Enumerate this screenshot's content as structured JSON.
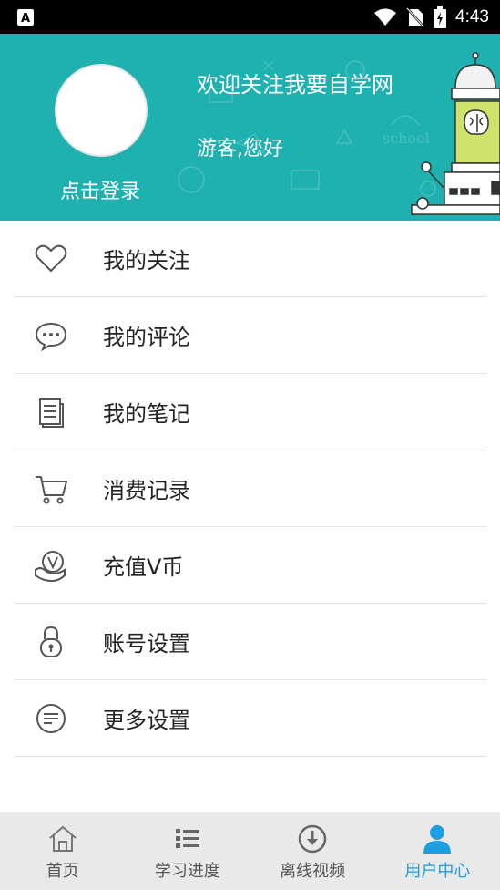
{
  "status_bar": {
    "time": "4:43",
    "icons": [
      "app-a-icon",
      "wifi-icon",
      "no-sim-icon",
      "battery-charging-icon"
    ]
  },
  "header": {
    "login_label": "点击登录",
    "welcome": "欢迎关注我要自学网",
    "greeting": "游客,您好",
    "background_color": "#1fb0b0"
  },
  "menu": {
    "items": [
      {
        "label": "我的关注",
        "icon": "heart-icon"
      },
      {
        "label": "我的评论",
        "icon": "comment-icon"
      },
      {
        "label": "我的笔记",
        "icon": "notes-icon"
      },
      {
        "label": "消费记录",
        "icon": "cart-icon"
      },
      {
        "label": "充值V币",
        "icon": "v-coin-icon"
      },
      {
        "label": "账号设置",
        "icon": "lock-icon"
      },
      {
        "label": "更多设置",
        "icon": "more-settings-icon"
      }
    ]
  },
  "bottom_nav": {
    "items": [
      {
        "label": "首页",
        "icon": "home-icon",
        "active": false
      },
      {
        "label": "学习进度",
        "icon": "list-icon",
        "active": false
      },
      {
        "label": "离线视频",
        "icon": "download-icon",
        "active": false
      },
      {
        "label": "用户中心",
        "icon": "user-icon",
        "active": true
      }
    ],
    "active_color": "#1b9fe0"
  }
}
